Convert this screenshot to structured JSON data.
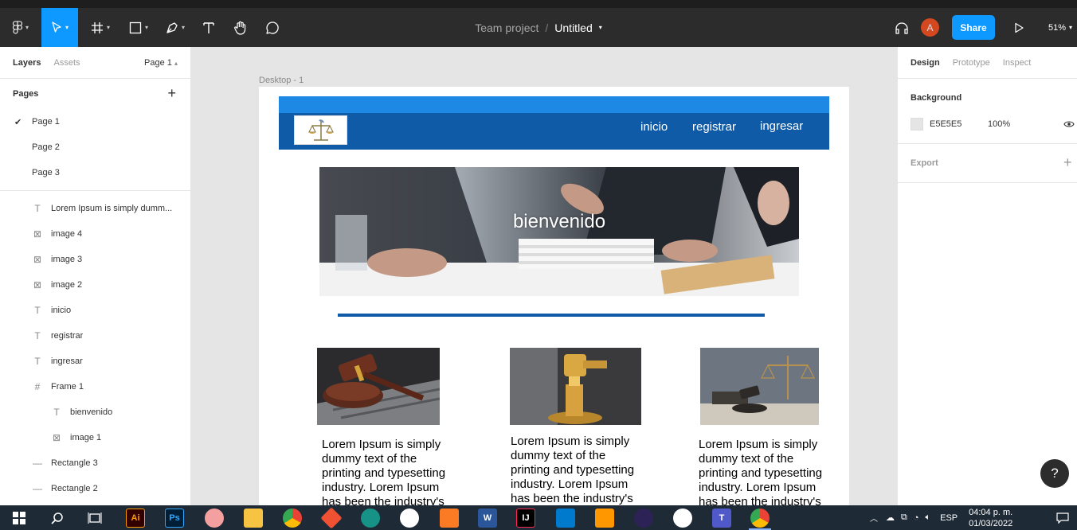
{
  "toolbar": {
    "project": "Team project",
    "separator": "/",
    "file_name": "Untitled",
    "share_label": "Share",
    "avatar_initial": "A",
    "zoom": "51%"
  },
  "left_panel": {
    "tabs": {
      "layers": "Layers",
      "assets": "Assets",
      "page_selector": "Page 1"
    },
    "pages_title": "Pages",
    "pages": [
      "Page 1",
      "Page 2",
      "Page 3"
    ],
    "active_page": "Page 1",
    "layers": [
      {
        "label": "Lorem Ipsum is simply dumm...",
        "icon": "text-icon"
      },
      {
        "label": "image 4",
        "icon": "image-icon"
      },
      {
        "label": "image 3",
        "icon": "image-icon"
      },
      {
        "label": "image 2",
        "icon": "image-icon"
      },
      {
        "label": "inicio",
        "icon": "text-icon"
      },
      {
        "label": "registrar",
        "icon": "text-icon"
      },
      {
        "label": "ingresar",
        "icon": "text-icon"
      },
      {
        "label": "Frame 1",
        "icon": "frame-icon"
      },
      {
        "label": "bienvenido",
        "icon": "text-icon"
      },
      {
        "label": "image 1",
        "icon": "image-icon"
      },
      {
        "label": "Rectangle 3",
        "icon": "line-icon"
      },
      {
        "label": "Rectangle 2",
        "icon": "line-icon"
      }
    ]
  },
  "canvas": {
    "frame_label": "Desktop - 1",
    "nav_links": [
      "inicio",
      "registrar",
      "ingresar"
    ],
    "hero_title": "bienvenido",
    "cards": [
      "Lorem Ipsum is simply dummy text of the printing and typesetting industry. Lorem Ipsum has been the industry's",
      "Lorem Ipsum is simply dummy text of the printing and typesetting industry. Lorem Ipsum has been the industry's",
      "Lorem Ipsum is simply dummy text of the printing and typesetting industry. Lorem Ipsum has been the industry's"
    ],
    "colors": {
      "nav": "#0f5ba7",
      "nav_top": "#1e88e5",
      "background": "#e5e5e5"
    }
  },
  "right_panel": {
    "tabs": [
      "Design",
      "Prototype",
      "Inspect"
    ],
    "active_tab": "Design",
    "background_title": "Background",
    "background_hex": "E5E5E5",
    "background_opacity": "100%",
    "export_title": "Export"
  },
  "help_label": "?",
  "taskbar": {
    "apps": [
      "windows-icon",
      "search-icon",
      "task-view-icon",
      "illustrator-icon",
      "photoshop-icon",
      "paint-icon",
      "file-explorer-icon",
      "chrome-icon",
      "git-icon",
      "gitkraken-icon",
      "github-icon",
      "xampp-icon",
      "word-icon",
      "intellij-icon",
      "vscode-icon",
      "sublime-icon",
      "eclipse-icon",
      "emoji-icon",
      "teams-icon",
      "chrome-profile-icon"
    ],
    "ai_label": "Ai",
    "ps_label": "Ps",
    "word_label": "W",
    "ij_label": "IJ",
    "teams_label": "T",
    "lang": "ESP",
    "time": "04:04 p. m.",
    "date": "01/03/2022"
  }
}
